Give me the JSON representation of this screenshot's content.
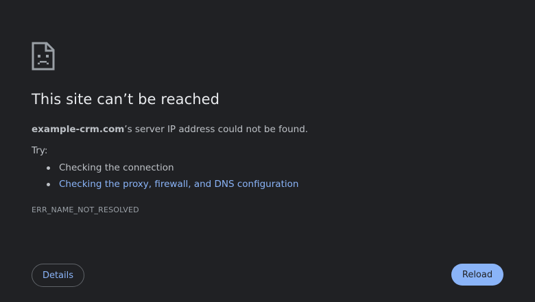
{
  "page": {
    "icon": "sad-page-icon",
    "title": "This site can’t be reached",
    "summary": {
      "host": "example-crm.com",
      "message": "’s server IP address could not be found."
    },
    "try_label": "Try:",
    "suggestions": [
      {
        "text": "Checking the connection",
        "is_link": false
      },
      {
        "text": "Checking the proxy, firewall, and DNS configuration",
        "is_link": true
      }
    ],
    "error_code": "ERR_NAME_NOT_RESOLVED"
  },
  "buttons": {
    "details_label": "Details",
    "reload_label": "Reload"
  },
  "colors": {
    "background": "#202124",
    "title": "#e8eaed",
    "body_text": "#bdc1c6",
    "link": "#8ab4f8",
    "primary_button": "#8ab4f8"
  }
}
